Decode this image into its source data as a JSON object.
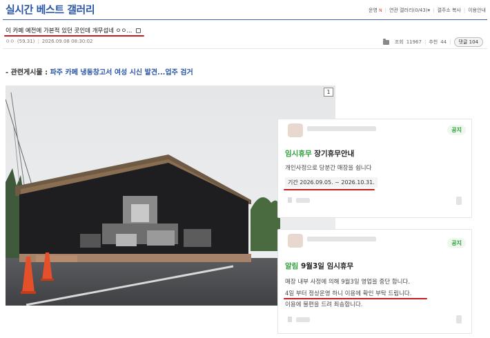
{
  "header": {
    "gallery_title": "실시간 베스트 갤러리",
    "nav": [
      {
        "label": "운영",
        "badge": "N"
      },
      {
        "label": "연관 갤러리(0/43)",
        "arrow": "▾"
      },
      {
        "label": "갤주소 복사"
      },
      {
        "label": "이용안내"
      }
    ]
  },
  "post": {
    "title": "이 카페 예전에 가본적 있던 곳인데 개무섭네 ㅇㅇ...",
    "author": "ㅇㅇ",
    "author_ip": "(59.31)",
    "datetime": "2026.09.08 08:30:02",
    "views_label": "조회",
    "views": "11967",
    "recommend_label": "추천",
    "recommend": "44",
    "replies_label": "댓글",
    "replies": "104"
  },
  "related": {
    "prefix": "- 관련게시물 :",
    "link": "파주 카페 냉동창고서 여성 시신 발견...업주 검거"
  },
  "image": {
    "number": "1"
  },
  "cards": [
    {
      "badge": "공지",
      "heading_accent": "임시휴무",
      "heading_rest": "장기휴무안내",
      "line1": "개인사정으로 당분간 매장을 쉽니다",
      "period": "기간 2026.09.05. ~ 2026.10.31."
    },
    {
      "badge": "공지",
      "heading_accent": "알림",
      "heading_rest": "9월3일 임시휴무",
      "line1": "매장 내부 사정에 의해 9월3일 영업을 중단 합니다.",
      "line2": "4일 부터 정상운영 하니 이용에 확인 부탁 드립니다.",
      "line3": "이용에 불편을 드려 죄송합니다."
    }
  ],
  "colors": {
    "title_blue": "#2a55a6",
    "underline_red": "#c71b1b",
    "notice_green": "#2e9e3a"
  }
}
